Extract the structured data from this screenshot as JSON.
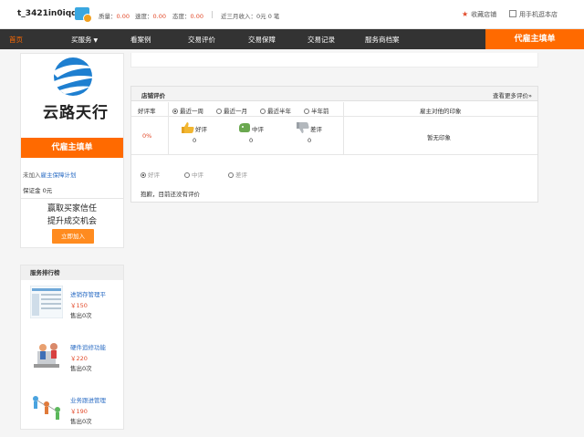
{
  "topbar": {
    "username": "t_3421in0iqq",
    "quality_label": "质量：",
    "quality_value": "0.00",
    "speed_label": "速度：",
    "speed_value": "0.00",
    "attitude_label": "态度：",
    "attitude_value": "0.00",
    "income_text": "近三月收入：0元 0 笔",
    "favorite": "收藏店铺",
    "mobile": "用手机逛本店"
  },
  "nav": {
    "home": "首页",
    "buy_service": "买服务",
    "cases": "看案例",
    "reviews": "交易评价",
    "guarantee": "交易保障",
    "records": "交易记录",
    "archive": "服务商档案",
    "post": "代雇主填单"
  },
  "left_card": {
    "logo_text": "云路天行",
    "post_button": "代雇主填单",
    "guarantee_prefix": "未加入",
    "guarantee_link": "雇主保障计划",
    "deposit": "保证金 0元",
    "slogan_line1": "赢取买家信任",
    "slogan_line2": "提升成交机会",
    "join_button": "立即加入"
  },
  "rank": {
    "title": "服务排行榜",
    "items": [
      {
        "name": "进销存管理平",
        "price": "￥150",
        "sold": "售出0次"
      },
      {
        "name": "硬件追修功能",
        "price": "￥220",
        "sold": "售出0次"
      },
      {
        "name": "业务跟进管理",
        "price": "￥190",
        "sold": "售出0次"
      }
    ]
  },
  "review": {
    "title": "店铺评价",
    "more": "查看更多评价»",
    "rate_label": "好评率",
    "periods": [
      "最近一周",
      "最近一月",
      "最近半年",
      "半年前"
    ],
    "impression_header": "雇主对他的印象",
    "rate_value": "0%",
    "good_label": "好评",
    "good_count": "0",
    "mid_label": "中评",
    "mid_count": "0",
    "bad_label": "差评",
    "bad_count": "0",
    "no_impression": "暂无印象",
    "filters": [
      "好评",
      "中评",
      "差评"
    ],
    "empty_text": "抱歉，目前还没有评价"
  },
  "colors": {
    "accent": "#ff6a00",
    "nav_bg": "#333333",
    "link": "#2a6cc4",
    "price": "#e24a2a"
  }
}
